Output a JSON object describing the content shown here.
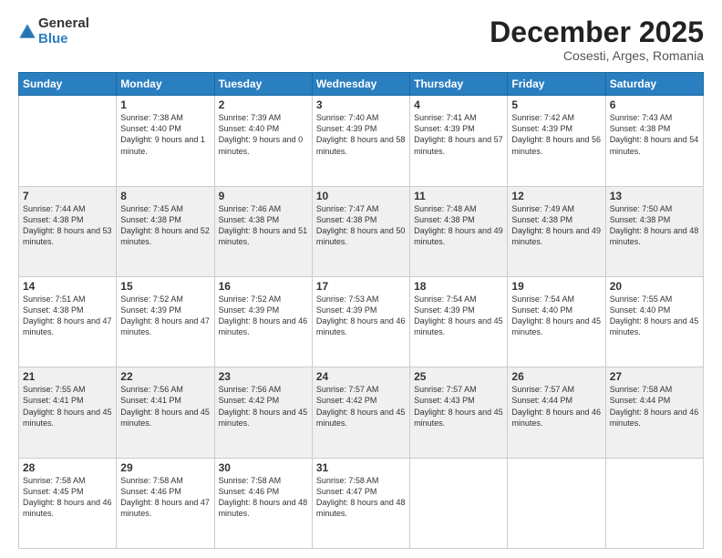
{
  "header": {
    "logo_general": "General",
    "logo_blue": "Blue",
    "main_title": "December 2025",
    "subtitle": "Cosesti, Arges, Romania"
  },
  "calendar": {
    "days_of_week": [
      "Sunday",
      "Monday",
      "Tuesday",
      "Wednesday",
      "Thursday",
      "Friday",
      "Saturday"
    ],
    "weeks": [
      [
        {
          "day": "",
          "sunrise": "",
          "sunset": "",
          "daylight": ""
        },
        {
          "day": "1",
          "sunrise": "Sunrise: 7:38 AM",
          "sunset": "Sunset: 4:40 PM",
          "daylight": "Daylight: 9 hours and 1 minute."
        },
        {
          "day": "2",
          "sunrise": "Sunrise: 7:39 AM",
          "sunset": "Sunset: 4:40 PM",
          "daylight": "Daylight: 9 hours and 0 minutes."
        },
        {
          "day": "3",
          "sunrise": "Sunrise: 7:40 AM",
          "sunset": "Sunset: 4:39 PM",
          "daylight": "Daylight: 8 hours and 58 minutes."
        },
        {
          "day": "4",
          "sunrise": "Sunrise: 7:41 AM",
          "sunset": "Sunset: 4:39 PM",
          "daylight": "Daylight: 8 hours and 57 minutes."
        },
        {
          "day": "5",
          "sunrise": "Sunrise: 7:42 AM",
          "sunset": "Sunset: 4:39 PM",
          "daylight": "Daylight: 8 hours and 56 minutes."
        },
        {
          "day": "6",
          "sunrise": "Sunrise: 7:43 AM",
          "sunset": "Sunset: 4:38 PM",
          "daylight": "Daylight: 8 hours and 54 minutes."
        }
      ],
      [
        {
          "day": "7",
          "sunrise": "Sunrise: 7:44 AM",
          "sunset": "Sunset: 4:38 PM",
          "daylight": "Daylight: 8 hours and 53 minutes."
        },
        {
          "day": "8",
          "sunrise": "Sunrise: 7:45 AM",
          "sunset": "Sunset: 4:38 PM",
          "daylight": "Daylight: 8 hours and 52 minutes."
        },
        {
          "day": "9",
          "sunrise": "Sunrise: 7:46 AM",
          "sunset": "Sunset: 4:38 PM",
          "daylight": "Daylight: 8 hours and 51 minutes."
        },
        {
          "day": "10",
          "sunrise": "Sunrise: 7:47 AM",
          "sunset": "Sunset: 4:38 PM",
          "daylight": "Daylight: 8 hours and 50 minutes."
        },
        {
          "day": "11",
          "sunrise": "Sunrise: 7:48 AM",
          "sunset": "Sunset: 4:38 PM",
          "daylight": "Daylight: 8 hours and 49 minutes."
        },
        {
          "day": "12",
          "sunrise": "Sunrise: 7:49 AM",
          "sunset": "Sunset: 4:38 PM",
          "daylight": "Daylight: 8 hours and 49 minutes."
        },
        {
          "day": "13",
          "sunrise": "Sunrise: 7:50 AM",
          "sunset": "Sunset: 4:38 PM",
          "daylight": "Daylight: 8 hours and 48 minutes."
        }
      ],
      [
        {
          "day": "14",
          "sunrise": "Sunrise: 7:51 AM",
          "sunset": "Sunset: 4:38 PM",
          "daylight": "Daylight: 8 hours and 47 minutes."
        },
        {
          "day": "15",
          "sunrise": "Sunrise: 7:52 AM",
          "sunset": "Sunset: 4:39 PM",
          "daylight": "Daylight: 8 hours and 47 minutes."
        },
        {
          "day": "16",
          "sunrise": "Sunrise: 7:52 AM",
          "sunset": "Sunset: 4:39 PM",
          "daylight": "Daylight: 8 hours and 46 minutes."
        },
        {
          "day": "17",
          "sunrise": "Sunrise: 7:53 AM",
          "sunset": "Sunset: 4:39 PM",
          "daylight": "Daylight: 8 hours and 46 minutes."
        },
        {
          "day": "18",
          "sunrise": "Sunrise: 7:54 AM",
          "sunset": "Sunset: 4:39 PM",
          "daylight": "Daylight: 8 hours and 45 minutes."
        },
        {
          "day": "19",
          "sunrise": "Sunrise: 7:54 AM",
          "sunset": "Sunset: 4:40 PM",
          "daylight": "Daylight: 8 hours and 45 minutes."
        },
        {
          "day": "20",
          "sunrise": "Sunrise: 7:55 AM",
          "sunset": "Sunset: 4:40 PM",
          "daylight": "Daylight: 8 hours and 45 minutes."
        }
      ],
      [
        {
          "day": "21",
          "sunrise": "Sunrise: 7:55 AM",
          "sunset": "Sunset: 4:41 PM",
          "daylight": "Daylight: 8 hours and 45 minutes."
        },
        {
          "day": "22",
          "sunrise": "Sunrise: 7:56 AM",
          "sunset": "Sunset: 4:41 PM",
          "daylight": "Daylight: 8 hours and 45 minutes."
        },
        {
          "day": "23",
          "sunrise": "Sunrise: 7:56 AM",
          "sunset": "Sunset: 4:42 PM",
          "daylight": "Daylight: 8 hours and 45 minutes."
        },
        {
          "day": "24",
          "sunrise": "Sunrise: 7:57 AM",
          "sunset": "Sunset: 4:42 PM",
          "daylight": "Daylight: 8 hours and 45 minutes."
        },
        {
          "day": "25",
          "sunrise": "Sunrise: 7:57 AM",
          "sunset": "Sunset: 4:43 PM",
          "daylight": "Daylight: 8 hours and 45 minutes."
        },
        {
          "day": "26",
          "sunrise": "Sunrise: 7:57 AM",
          "sunset": "Sunset: 4:44 PM",
          "daylight": "Daylight: 8 hours and 46 minutes."
        },
        {
          "day": "27",
          "sunrise": "Sunrise: 7:58 AM",
          "sunset": "Sunset: 4:44 PM",
          "daylight": "Daylight: 8 hours and 46 minutes."
        }
      ],
      [
        {
          "day": "28",
          "sunrise": "Sunrise: 7:58 AM",
          "sunset": "Sunset: 4:45 PM",
          "daylight": "Daylight: 8 hours and 46 minutes."
        },
        {
          "day": "29",
          "sunrise": "Sunrise: 7:58 AM",
          "sunset": "Sunset: 4:46 PM",
          "daylight": "Daylight: 8 hours and 47 minutes."
        },
        {
          "day": "30",
          "sunrise": "Sunrise: 7:58 AM",
          "sunset": "Sunset: 4:46 PM",
          "daylight": "Daylight: 8 hours and 48 minutes."
        },
        {
          "day": "31",
          "sunrise": "Sunrise: 7:58 AM",
          "sunset": "Sunset: 4:47 PM",
          "daylight": "Daylight: 8 hours and 48 minutes."
        },
        {
          "day": "",
          "sunrise": "",
          "sunset": "",
          "daylight": ""
        },
        {
          "day": "",
          "sunrise": "",
          "sunset": "",
          "daylight": ""
        },
        {
          "day": "",
          "sunrise": "",
          "sunset": "",
          "daylight": ""
        }
      ]
    ]
  }
}
